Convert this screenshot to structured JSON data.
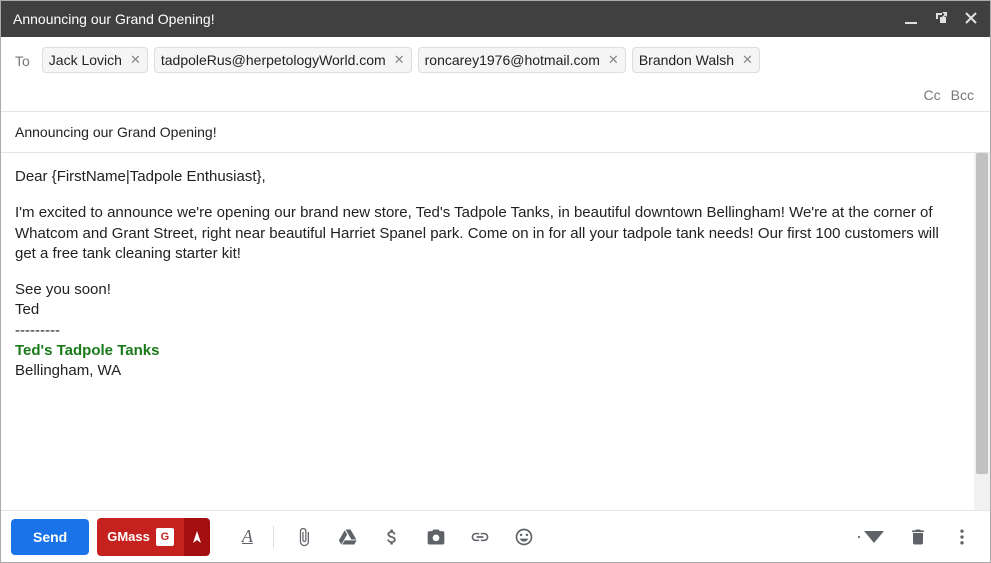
{
  "header": {
    "title": "Announcing our Grand Opening!"
  },
  "to": {
    "label": "To",
    "recipients": [
      "Jack Lovich",
      "tadpoleRus@herpetologyWorld.com",
      "roncarey1976@hotmail.com",
      "Brandon Walsh"
    ],
    "cc_label": "Cc",
    "bcc_label": "Bcc"
  },
  "subject": "Announcing our Grand Opening!",
  "body": {
    "greeting": "Dear {FirstName|Tadpole Enthusiast},",
    "para1": "I'm excited to announce we're opening our brand new store, Ted's Tadpole Tanks, in beautiful downtown Bellingham! We're at the corner of Whatcom and Grant Street, right near beautiful Harriet Spanel park. Come on in for all your tadpole tank needs! Our first 100 customers will get a free tank cleaning starter kit!",
    "closing1": "See you soon!",
    "closing2": "Ted",
    "sig_divider": "---------",
    "sig_name": "Ted's Tadpole Tanks",
    "sig_location": "Bellingham, WA"
  },
  "toolbar": {
    "send_label": "Send",
    "gmass_label": "GMass"
  }
}
